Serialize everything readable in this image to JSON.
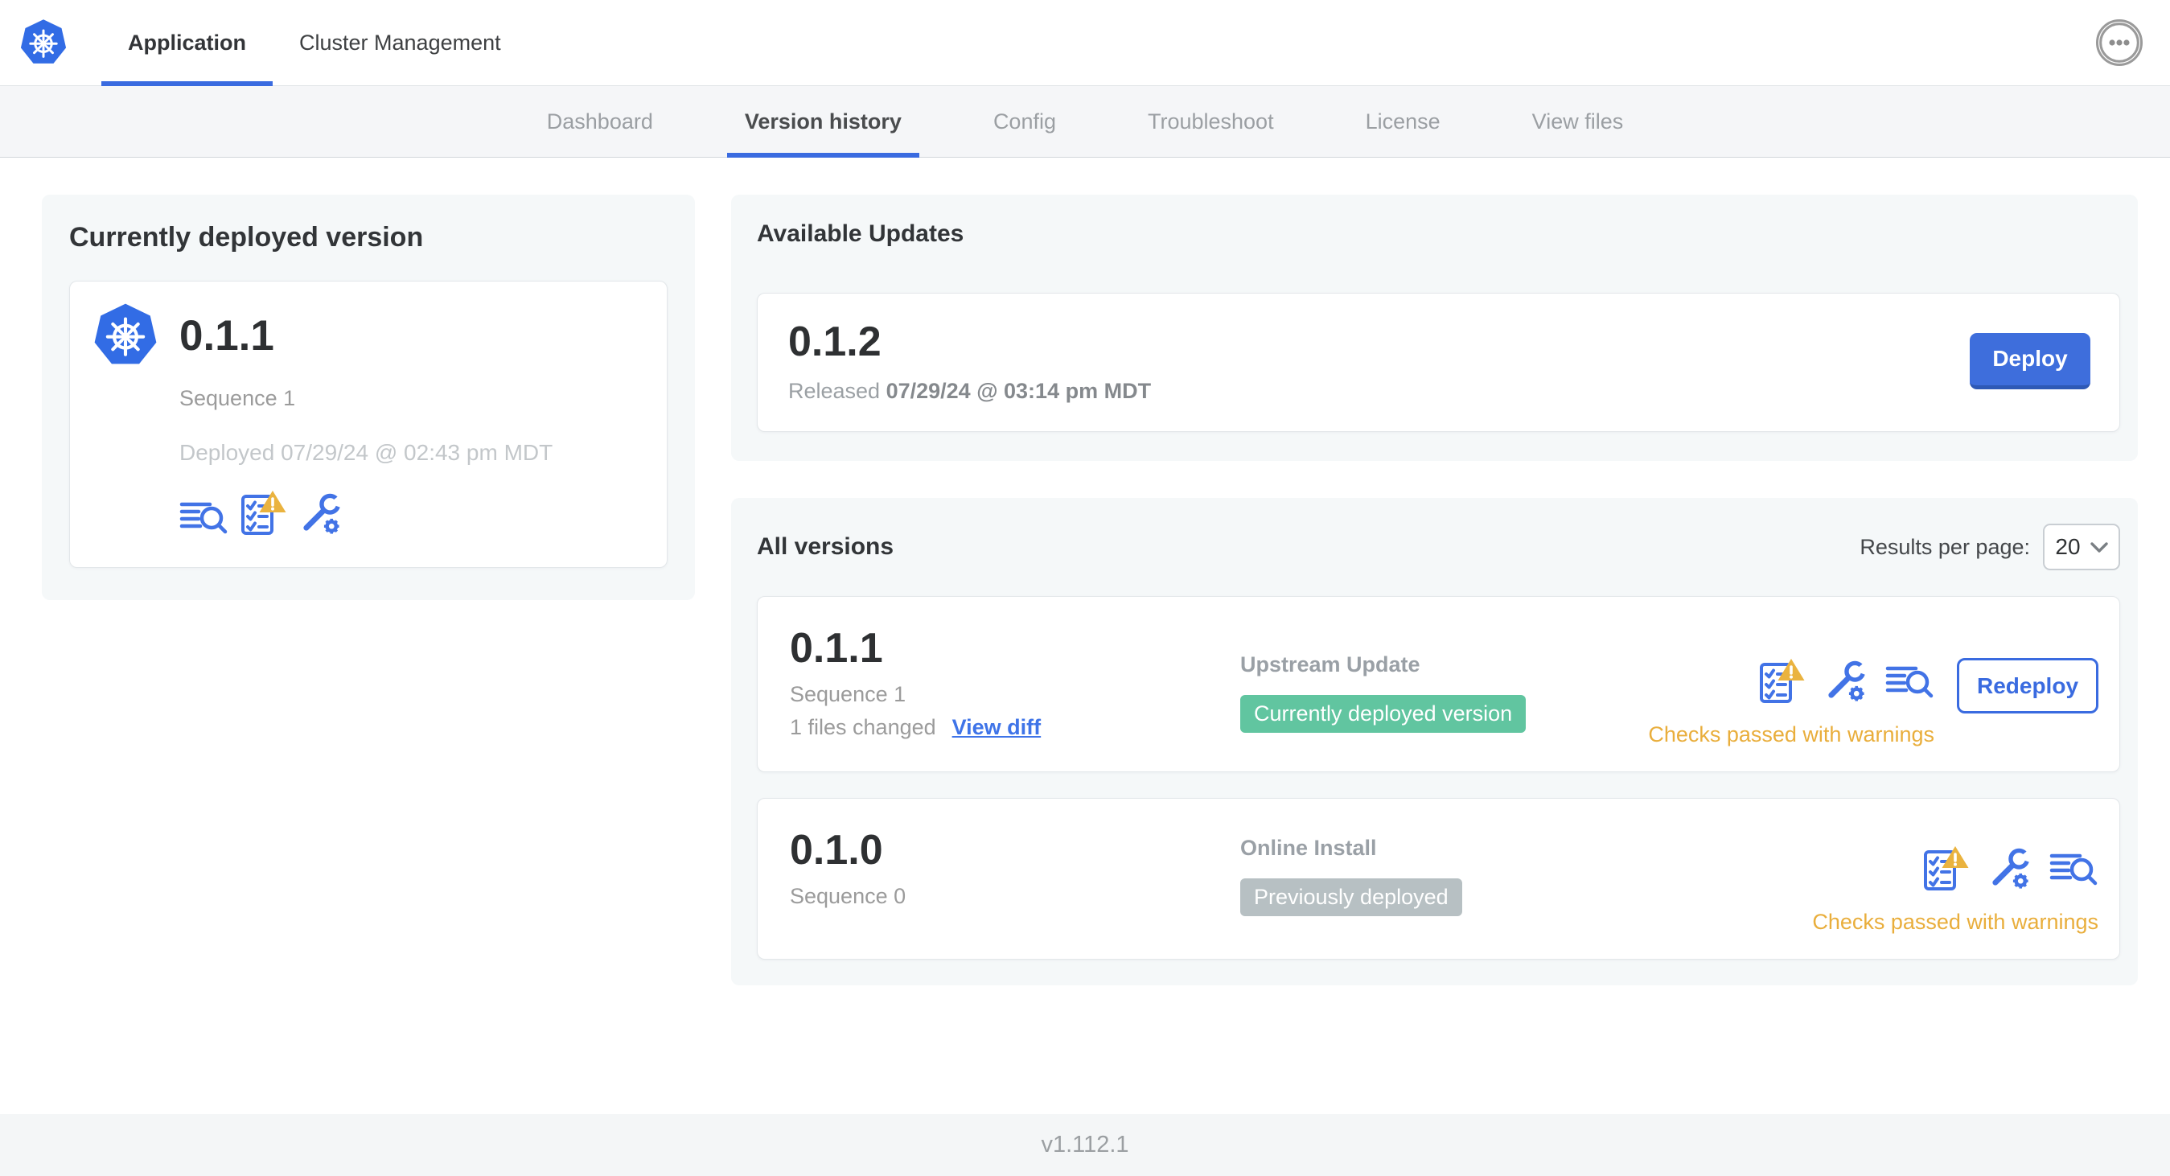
{
  "header": {
    "tabs": [
      {
        "label": "Application",
        "active": true
      },
      {
        "label": "Cluster Management",
        "active": false
      }
    ],
    "more_menu_icon": "ellipsis-in-circle"
  },
  "subnav": {
    "tabs": [
      {
        "label": "Dashboard",
        "active": false
      },
      {
        "label": "Version history",
        "active": true
      },
      {
        "label": "Config",
        "active": false
      },
      {
        "label": "Troubleshoot",
        "active": false
      },
      {
        "label": "License",
        "active": false
      },
      {
        "label": "View files",
        "active": false
      }
    ]
  },
  "current_version": {
    "section_title": "Currently deployed version",
    "version": "0.1.1",
    "sequence": "Sequence 1",
    "deployed": "Deployed 07/29/24 @ 02:43 pm MDT",
    "icons": [
      "logs-icon",
      "preflight-checks-warning-icon",
      "config-icon"
    ]
  },
  "available_updates": {
    "section_title": "Available Updates",
    "version": "0.1.2",
    "released_prefix": "Released",
    "released_date": "07/29/24 @ 03:14 pm MDT",
    "deploy_label": "Deploy"
  },
  "all_versions": {
    "section_title": "All versions",
    "results_label": "Results per page:",
    "results_value": "20",
    "rows": [
      {
        "version": "0.1.1",
        "sequence": "Sequence 1",
        "files_changed": "1 files changed",
        "view_diff_label": "View diff",
        "source": "Upstream Update",
        "badge_label": "Currently deployed version",
        "badge_color": "green",
        "icons": [
          "preflight-checks-warning-icon",
          "config-icon",
          "logs-icon"
        ],
        "action_label": "Redeploy",
        "status": "Checks passed with warnings"
      },
      {
        "version": "0.1.0",
        "sequence": "Sequence 0",
        "source": "Online Install",
        "badge_label": "Previously deployed",
        "badge_color": "gray",
        "icons": [
          "preflight-checks-warning-icon",
          "config-icon",
          "logs-icon"
        ],
        "status": "Checks passed with warnings"
      }
    ]
  },
  "footer": {
    "app_version": "v1.112.1"
  },
  "colors": {
    "primary_blue": "#3a6be0",
    "kubernetes_blue": "#326ce5",
    "success_green": "#61c5a0",
    "muted_badge_gray": "#b7c0c3",
    "warning_amber": "#e9ae3c",
    "section_background": "#f5f8f9"
  }
}
